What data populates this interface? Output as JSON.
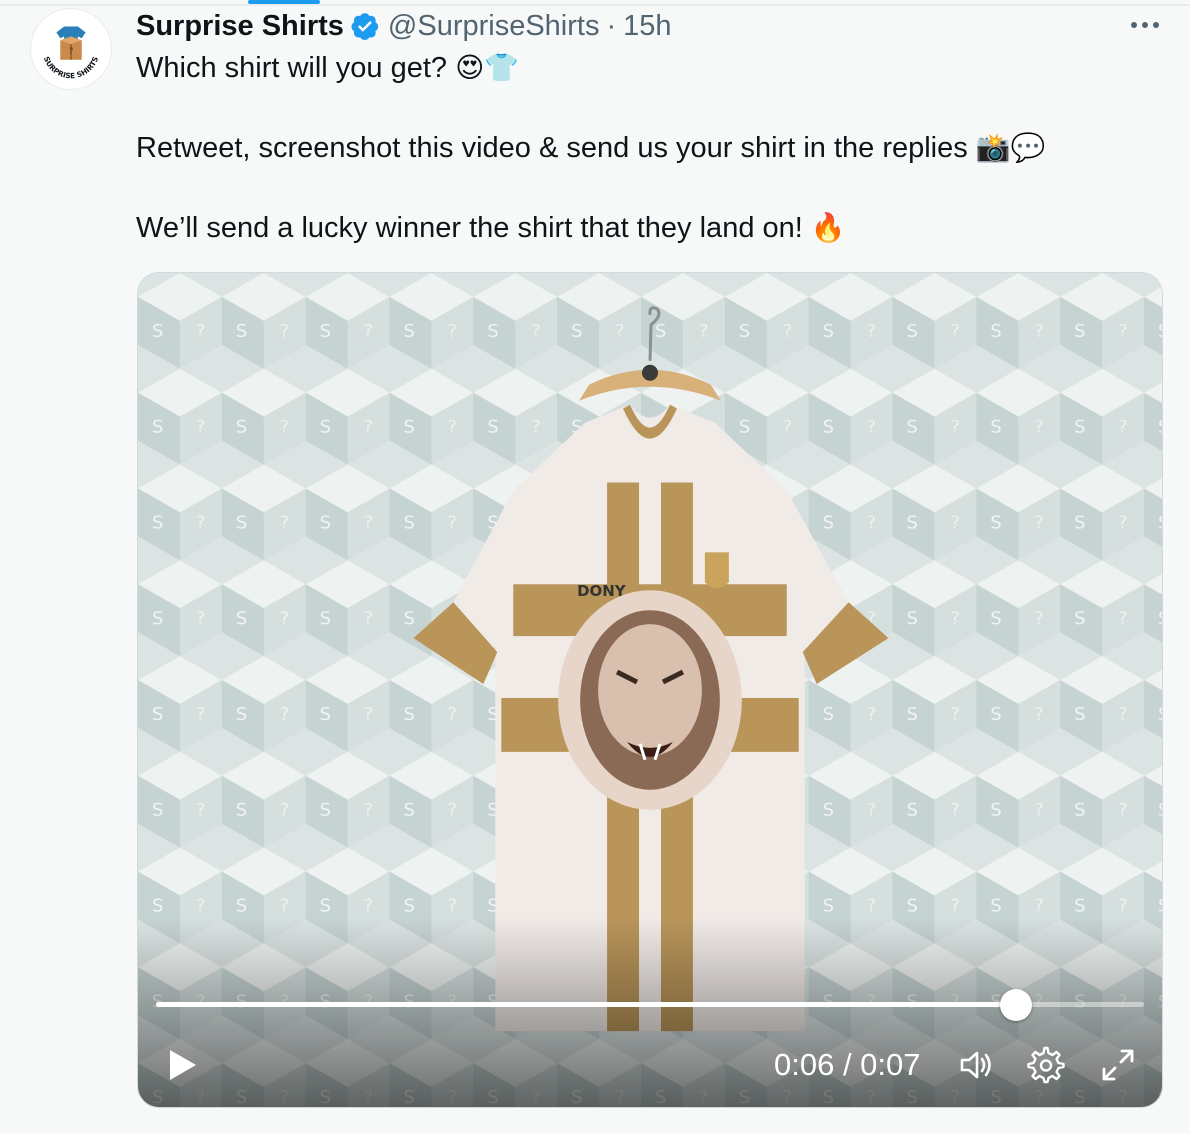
{
  "tweet": {
    "display_name": "Surprise Shirts",
    "handle": "@SurpriseShirts",
    "separator": "·",
    "time": "15h",
    "avatar_logo_text": "SURPRISE SHIRTS",
    "lines": [
      {
        "text": "Which shirt will you get? ",
        "emoji": "😍👕"
      },
      {
        "text": "Retweet, screenshot this video & send us your shirt in the replies ",
        "emoji": "📸💬"
      },
      {
        "text": "We’ll send a lucky winner the shirt that they land on! ",
        "emoji": "🔥"
      }
    ]
  },
  "video": {
    "current_time": "0:06",
    "duration": "0:07",
    "time_label": "0:06 / 0:07",
    "progress_fraction": 0.87,
    "shirt_brand": "DONY"
  },
  "icons": {
    "verified": "verified-badge-icon",
    "more": "more-options-icon",
    "play": "play-icon",
    "volume": "volume-icon",
    "settings": "gear-icon",
    "fullscreen": "fullscreen-icon"
  },
  "colors": {
    "accent": "#1d9bf0",
    "text": "#0f1419",
    "muted": "#536471",
    "shirt_gold": "#b9955a",
    "wall": "#dfe7e6"
  }
}
